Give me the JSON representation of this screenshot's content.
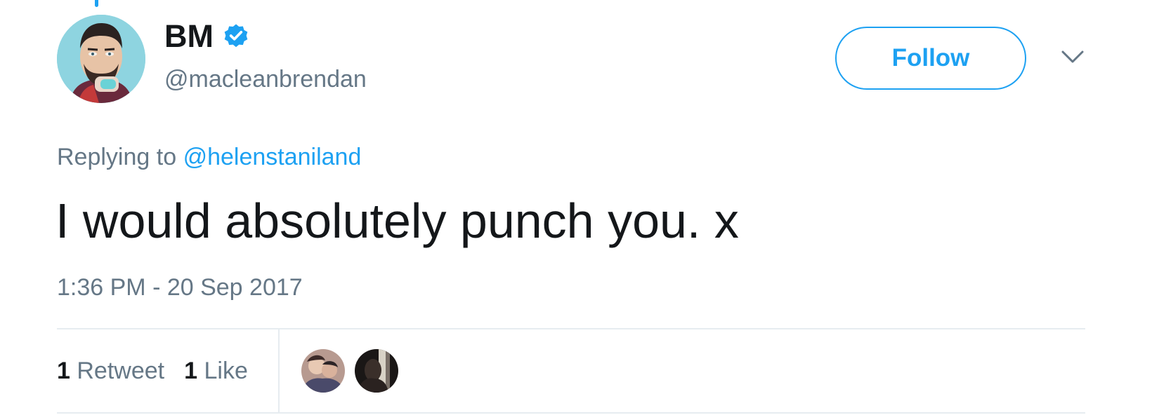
{
  "tweet": {
    "author": {
      "display_name": "BM",
      "handle": "@macleanbrendan",
      "verified_icon": "verified-badge-icon"
    },
    "follow_label": "Follow",
    "menu_icon": "chevron-down-icon",
    "reply_prefix": "Replying to",
    "reply_mention": "@helenstaniland",
    "text": "I would absolutely punch you. x",
    "timestamp": "1:36 PM - 20 Sep 2017",
    "stats": {
      "retweets_count": "1",
      "retweets_label": "Retweet",
      "likes_count": "1",
      "likes_label": "Like"
    }
  },
  "colors": {
    "accent": "#1da1f2",
    "text_primary": "#14171a",
    "text_secondary": "#657786",
    "divider": "#e6ecf0"
  }
}
